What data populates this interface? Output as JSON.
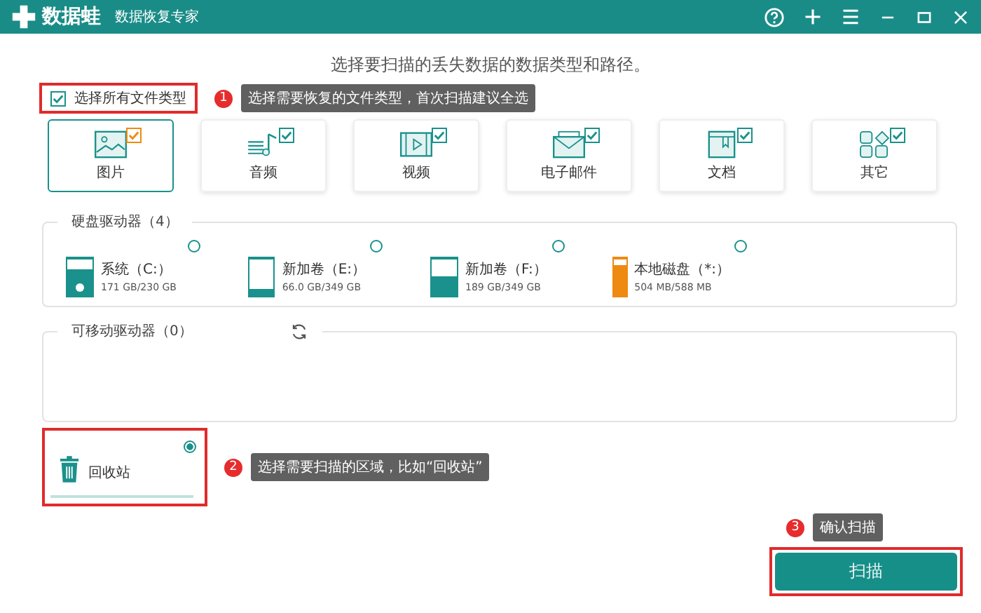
{
  "app": {
    "name": "数据蛙",
    "subtitle": "数据恢复专家"
  },
  "heading": "选择要扫描的丢失数据的数据类型和路径。",
  "select_all": {
    "label": "选择所有文件类型",
    "checked": true,
    "highlighted": true
  },
  "categories": [
    {
      "kind": "image",
      "label": "图片",
      "checked": true,
      "selected": true
    },
    {
      "kind": "music",
      "label": "音频",
      "checked": true,
      "selected": false
    },
    {
      "kind": "video",
      "label": "视频",
      "checked": true,
      "selected": false
    },
    {
      "kind": "email",
      "label": "电子邮件",
      "checked": true,
      "selected": false
    },
    {
      "kind": "document",
      "label": "文档",
      "checked": true,
      "selected": false
    },
    {
      "kind": "other",
      "label": "其它",
      "checked": true,
      "selected": false
    }
  ],
  "hard_drives": {
    "title": "硬盘驱动器（4）",
    "drives": [
      {
        "name": "系统（C:）",
        "capacity": "171 GB/230 GB",
        "level": 0.74,
        "color": "#1a918c",
        "system": true,
        "selected": false
      },
      {
        "name": "新加卷（E:）",
        "capacity": "66.0 GB/349 GB",
        "level": 0.19,
        "color": "#1a918c",
        "system": false,
        "selected": false
      },
      {
        "name": "新加卷（F:）",
        "capacity": "189 GB/349 GB",
        "level": 0.54,
        "color": "#1a918c",
        "system": false,
        "selected": false
      },
      {
        "name": "本地磁盘（*:）",
        "capacity": "504 MB/588 MB",
        "level": 0.86,
        "color": "#ee8a12",
        "system": false,
        "selected": false
      }
    ]
  },
  "removable_drives": {
    "title": "可移动驱动器（0）"
  },
  "recycle_bin": {
    "label": "回收站",
    "selected": true,
    "highlighted": true
  },
  "scan_button": {
    "label": "扫描",
    "highlighted": true
  },
  "callouts": [
    {
      "number": "1",
      "text": "选择需要恢复的文件类型，首次扫描建议全选"
    },
    {
      "number": "2",
      "text": "选择需要扫描的区域，比如“回收站”"
    },
    {
      "number": "3",
      "text": "确认扫描"
    }
  ]
}
